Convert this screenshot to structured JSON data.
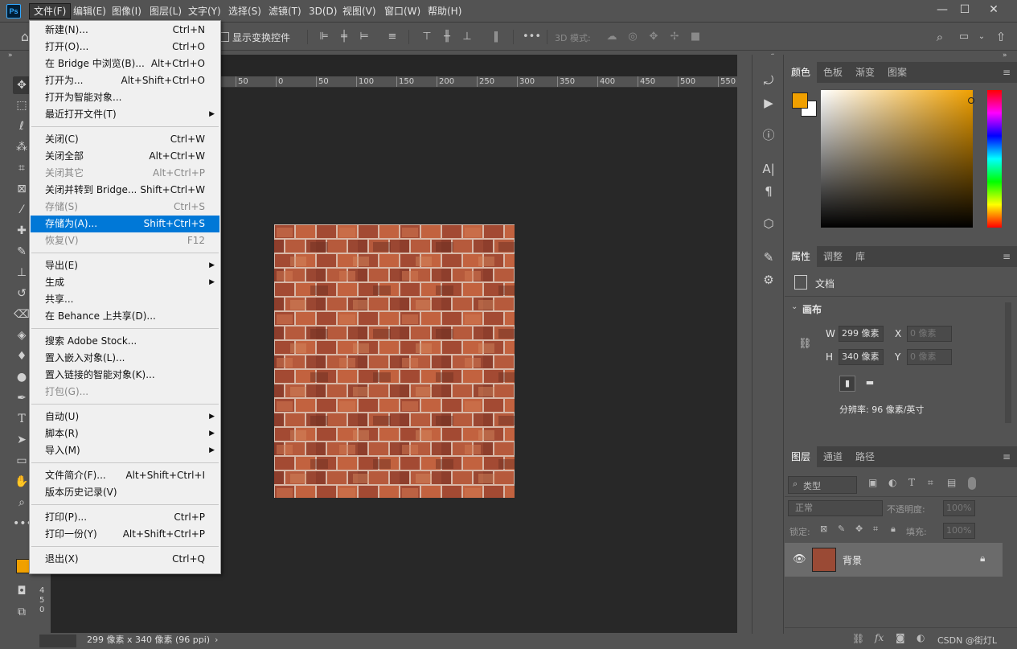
{
  "app": {
    "logo": "Ps"
  },
  "menubar": {
    "items": [
      "文件(F)",
      "编辑(E)",
      "图像(I)",
      "图层(L)",
      "文字(Y)",
      "选择(S)",
      "滤镜(T)",
      "3D(D)",
      "视图(V)",
      "窗口(W)",
      "帮助(H)"
    ],
    "window_controls": {
      "minimize": "—",
      "restore": "☐",
      "close": "✕"
    }
  },
  "optionsbar": {
    "show_transform_label": "显示变换控件",
    "mode3d_label": "3D 模式:"
  },
  "ruler": {
    "top_ticks": [
      "50",
      "0",
      "50",
      "100",
      "150",
      "200",
      "250",
      "300",
      "350",
      "400",
      "450",
      "500",
      "550"
    ],
    "left_ticks": [
      "4",
      "5",
      "0"
    ]
  },
  "filemenu": {
    "items": [
      {
        "label": "新建(N)...",
        "shortcut": "Ctrl+N"
      },
      {
        "label": "打开(O)...",
        "shortcut": "Ctrl+O"
      },
      {
        "label": "在 Bridge 中浏览(B)...",
        "shortcut": "Alt+Ctrl+O"
      },
      {
        "label": "打开为...",
        "shortcut": "Alt+Shift+Ctrl+O"
      },
      {
        "label": "打开为智能对象...",
        "shortcut": ""
      },
      {
        "label": "最近打开文件(T)",
        "shortcut": "",
        "submenu": true
      },
      {
        "sep": true
      },
      {
        "label": "关闭(C)",
        "shortcut": "Ctrl+W"
      },
      {
        "label": "关闭全部",
        "shortcut": "Alt+Ctrl+W"
      },
      {
        "label": "关闭其它",
        "shortcut": "Alt+Ctrl+P",
        "disabled": true
      },
      {
        "label": "关闭并转到 Bridge...",
        "shortcut": "Shift+Ctrl+W"
      },
      {
        "label": "存储(S)",
        "shortcut": "Ctrl+S",
        "disabled": true
      },
      {
        "label": "存储为(A)...",
        "shortcut": "Shift+Ctrl+S",
        "highlighted": true
      },
      {
        "label": "恢复(V)",
        "shortcut": "F12",
        "disabled": true
      },
      {
        "sep": true
      },
      {
        "label": "导出(E)",
        "shortcut": "",
        "submenu": true
      },
      {
        "label": "生成",
        "shortcut": "",
        "submenu": true
      },
      {
        "label": "共享...",
        "shortcut": ""
      },
      {
        "label": "在 Behance 上共享(D)...",
        "shortcut": ""
      },
      {
        "sep": true
      },
      {
        "label": "搜索 Adobe Stock...",
        "shortcut": ""
      },
      {
        "label": "置入嵌入对象(L)...",
        "shortcut": ""
      },
      {
        "label": "置入链接的智能对象(K)...",
        "shortcut": ""
      },
      {
        "label": "打包(G)...",
        "shortcut": "",
        "disabled": true
      },
      {
        "sep": true
      },
      {
        "label": "自动(U)",
        "shortcut": "",
        "submenu": true
      },
      {
        "label": "脚本(R)",
        "shortcut": "",
        "submenu": true
      },
      {
        "label": "导入(M)",
        "shortcut": "",
        "submenu": true
      },
      {
        "sep": true
      },
      {
        "label": "文件简介(F)...",
        "shortcut": "Alt+Shift+Ctrl+I"
      },
      {
        "label": "版本历史记录(V)",
        "shortcut": ""
      },
      {
        "sep": true
      },
      {
        "label": "打印(P)...",
        "shortcut": "Ctrl+P"
      },
      {
        "label": "打印一份(Y)",
        "shortcut": "Alt+Shift+Ctrl+P"
      },
      {
        "sep": true
      },
      {
        "label": "退出(X)",
        "shortcut": "Ctrl+Q"
      }
    ]
  },
  "colorpanel": {
    "tabs": [
      "颜色",
      "色板",
      "渐变",
      "图案"
    ],
    "foreground": "#f0a000",
    "background": "#ffffff"
  },
  "propertiespanel": {
    "tabs": [
      "属性",
      "调整",
      "库"
    ],
    "doc_label": "文档",
    "section": "画布",
    "w_label": "W",
    "w_value": "299 像素",
    "x_label": "X",
    "x_value": "0 像素",
    "h_label": "H",
    "h_value": "340 像素",
    "y_label": "Y",
    "y_value": "0 像素",
    "resolution": "分辨率: 96 像素/英寸"
  },
  "layerspanel": {
    "tabs": [
      "图层",
      "通道",
      "路径"
    ],
    "filter_label": "类型",
    "blend_mode": "正常",
    "opacity_label": "不透明度:",
    "opacity_value": "100%",
    "lock_label": "锁定:",
    "fill_label": "填充:",
    "fill_value": "100%",
    "layers": [
      {
        "name": "背景"
      }
    ],
    "watermark": "CSDN @街灯L"
  },
  "status": {
    "text": "299 像素 x 340 像素 (96 ppi)"
  }
}
